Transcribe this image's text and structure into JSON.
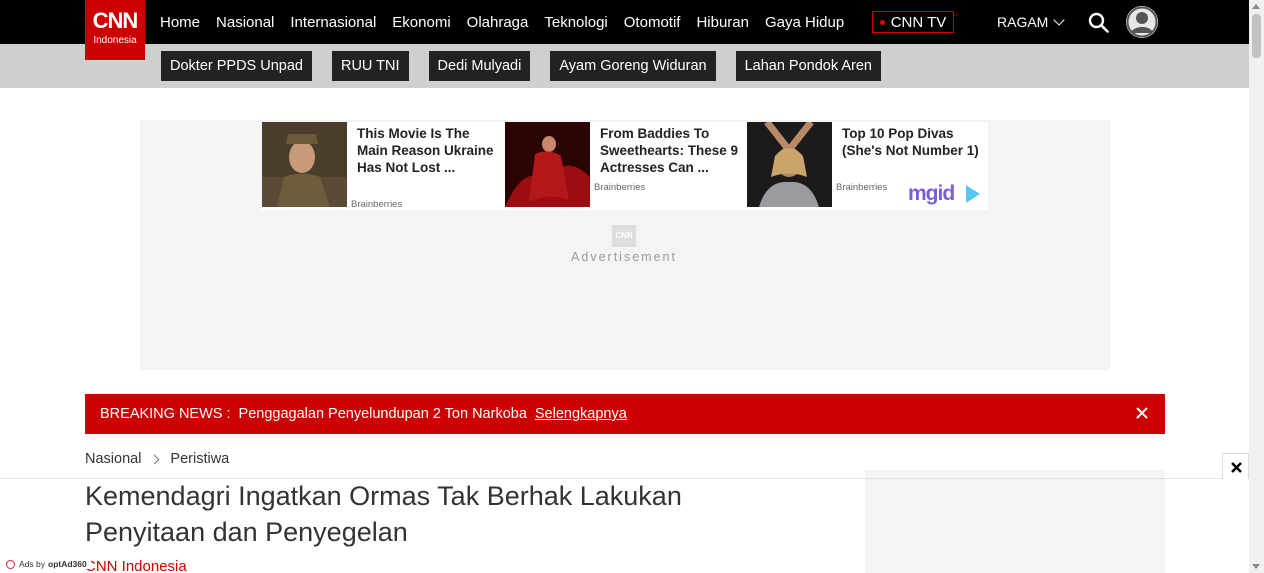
{
  "brand": {
    "logo_main": "CNN",
    "logo_sub": "Indonesia",
    "color": "#cc0000"
  },
  "nav": {
    "items": [
      "Home",
      "Nasional",
      "Internasional",
      "Ekonomi",
      "Olahraga",
      "Teknologi",
      "Otomotif",
      "Hiburan",
      "Gaya Hidup"
    ],
    "tv_label": "CNN TV",
    "ragam_label": "RAGAM",
    "icons": {
      "search": "search-icon",
      "profile": "user-avatar-icon"
    }
  },
  "tags": [
    "Dokter PPDS Unpad",
    "RUU TNI",
    "Dedi Mulyadi",
    "Ayam Goreng Widuran",
    "Lahan Pondok Aren"
  ],
  "ads": {
    "cards": [
      {
        "title": "This Movie Is The Main Reason Ukraine Has Not Lost ...",
        "source": "Brainberries"
      },
      {
        "title": "From Baddies To Sweethearts: These 9 Actresses Can ...",
        "source": "Brainberries"
      },
      {
        "title": "Top 10 Pop Divas (She's Not Number 1)",
        "source": "Brainberries"
      }
    ],
    "network_logo": "mgid",
    "ad_mark": "CNN",
    "advertisement_label": "Advertisement"
  },
  "breaking": {
    "label": "BREAKING NEWS :",
    "text": "Penggagalan Penyelundupan 2 Ton Narkoba",
    "link": "Selengkapnya"
  },
  "breadcrumb": [
    "Nasional",
    "Peristiwa"
  ],
  "article": {
    "headline": "Kemendagri Ingatkan Ormas Tak Berhak Lakukan Penyitaan dan Penyegelan",
    "byline": "CNN Indonesia"
  },
  "sticky_ad": {
    "ads_by": "Ads by",
    "provider": "optAd360"
  }
}
